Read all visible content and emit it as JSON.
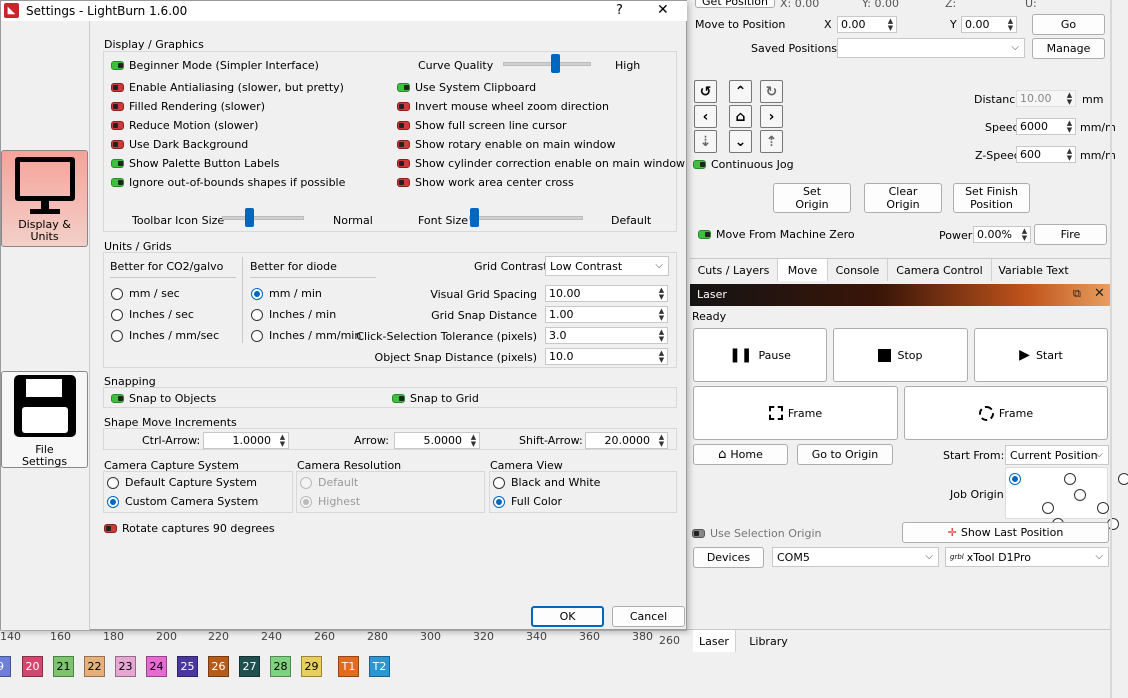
{
  "window": {
    "title": "Settings - LightBurn 1.6.00",
    "help": "?",
    "close": "✕"
  },
  "nav": [
    {
      "label": "Display &\nUnits"
    },
    {
      "label": "File\nSettings"
    }
  ],
  "display": {
    "title": "Display / Graphics",
    "curve_quality": "Curve Quality",
    "curve_high": "High",
    "left_opts": [
      {
        "label": "Beginner Mode (Simpler Interface)",
        "state": "on"
      },
      {
        "label": "Enable Antialiasing (slower, but pretty)",
        "state": "off"
      },
      {
        "label": "Filled Rendering (slower)",
        "state": "off"
      },
      {
        "label": "Reduce Motion (slower)",
        "state": "off"
      },
      {
        "label": "Use Dark Background",
        "state": "off"
      },
      {
        "label": "Show Palette Button Labels",
        "state": "on"
      },
      {
        "label": "Ignore out-of-bounds shapes if possible",
        "state": "on"
      }
    ],
    "right_opts": [
      {
        "label": "Use System Clipboard",
        "state": "on"
      },
      {
        "label": "Invert mouse wheel zoom direction",
        "state": "off"
      },
      {
        "label": "Show full screen line cursor",
        "state": "off"
      },
      {
        "label": "Show rotary enable on main window",
        "state": "off"
      },
      {
        "label": "Show cylinder correction enable on main window",
        "state": "off"
      },
      {
        "label": "Show work area center cross",
        "state": "off"
      }
    ],
    "toolbar_icon_size": "Toolbar Icon Size",
    "toolbar_normal": "Normal",
    "font_size": "Font Size",
    "font_default": "Default"
  },
  "units": {
    "title": "Units / Grids",
    "co2_title": "Better for CO2/galvo",
    "co2_opts": [
      "mm / sec",
      "Inches / sec",
      "Inches / mm/sec"
    ],
    "diode_title": "Better for diode",
    "diode_opts": [
      "mm / min",
      "Inches / min",
      "Inches / mm/min"
    ],
    "grid_contrast_label": "Grid Contrast",
    "grid_contrast_value": "Low Contrast",
    "fields": [
      {
        "label": "Visual Grid Spacing",
        "value": "10.00"
      },
      {
        "label": "Grid Snap Distance",
        "value": "1.00"
      },
      {
        "label": "Click-Selection Tolerance (pixels)",
        "value": "3.0"
      },
      {
        "label": "Object Snap Distance (pixels)",
        "value": "10.0"
      }
    ]
  },
  "snapping": {
    "title": "Snapping",
    "objects": "Snap to Objects",
    "grid": "Snap to Grid"
  },
  "increments": {
    "title": "Shape Move Increments",
    "ctrl_label": "Ctrl-Arrow:",
    "ctrl_value": "1.0000",
    "arrow_label": "Arrow:",
    "arrow_value": "5.0000",
    "shift_label": "Shift-Arrow:",
    "shift_value": "20.0000"
  },
  "camera": {
    "capture_title": "Camera Capture System",
    "capture_opts": [
      "Default Capture System",
      "Custom Camera System"
    ],
    "res_title": "Camera Resolution",
    "res_opts": [
      "Default",
      "Highest"
    ],
    "view_title": "Camera View",
    "view_opts": [
      "Black and White",
      "Full Color"
    ],
    "rotate": "Rotate captures 90 degrees"
  },
  "dialog_buttons": {
    "ok": "OK",
    "cancel": "Cancel"
  },
  "ruler": {
    "labels": [
      "140",
      "160",
      "180",
      "200",
      "220",
      "240",
      "260",
      "280",
      "300",
      "320",
      "340",
      "360",
      "380"
    ],
    "side": "260"
  },
  "palette": [
    {
      "label": "9",
      "color": "#6f7ed8"
    },
    {
      "label": "20",
      "color": "#d4456f"
    },
    {
      "label": "21",
      "color": "#7cc46e"
    },
    {
      "label": "22",
      "color": "#e6b07c"
    },
    {
      "label": "23",
      "color": "#e6a8d2"
    },
    {
      "label": "24",
      "color": "#e56bd0"
    },
    {
      "label": "25",
      "color": "#4a36a0"
    },
    {
      "label": "26",
      "color": "#b65c1a"
    },
    {
      "label": "27",
      "color": "#1f4f4f"
    },
    {
      "label": "28",
      "color": "#7fd27f"
    },
    {
      "label": "29",
      "color": "#e8cf5a"
    },
    {
      "label": "T1",
      "color": "#e46a1e"
    },
    {
      "label": "T2",
      "color": "#2a96d2"
    }
  ],
  "move": {
    "get_position": "Get Position",
    "x_label": "X: 0.00",
    "y_label": "Y: 0.00",
    "z_label": "Z:",
    "u_label": "U:",
    "move_to": "Move to Position",
    "x": "X",
    "x_value": "0.00",
    "y": "Y",
    "y_value": "0.00",
    "go": "Go",
    "saved": "Saved Positions:",
    "manage": "Manage",
    "distance_label": "Distance",
    "distance_value": "10.00",
    "distance_unit": "mm",
    "speed_label": "Speed",
    "speed_value": "6000",
    "speed_unit": "mm/m",
    "zspeed_label": "Z-Speed",
    "zspeed_value": "600",
    "zspeed_unit": "mm/m",
    "continuous": "Continuous Jog",
    "set_origin": "Set\nOrigin",
    "clear_origin": "Clear\nOrigin",
    "set_finish": "Set Finish\nPosition",
    "from_zero": "Move From Machine Zero",
    "power_label": "Power",
    "power_value": "0.00%",
    "fire": "Fire"
  },
  "tabs": [
    "Cuts / Layers",
    "Move",
    "Console",
    "Camera Control",
    "Variable Text"
  ],
  "active_tab": "Move",
  "laser": {
    "title": "Laser",
    "status": "Ready",
    "pause": "Pause",
    "stop": "Stop",
    "start": "Start",
    "frame1": "Frame",
    "frame2": "Frame",
    "home": "Home",
    "go_origin": "Go to Origin",
    "start_from_label": "Start From:",
    "start_from_value": "Current Position",
    "job_origin": "Job Origin",
    "use_selection": "Use Selection Origin",
    "show_last": "Show Last Position",
    "devices": "Devices",
    "port": "COM5",
    "grbl": "grbl",
    "machine": "xTool D1Pro"
  },
  "bottom_tabs": [
    "Laser",
    "Library"
  ],
  "colors": {
    "accent": "#0067c0",
    "laser_header": "#1f1f1f"
  }
}
